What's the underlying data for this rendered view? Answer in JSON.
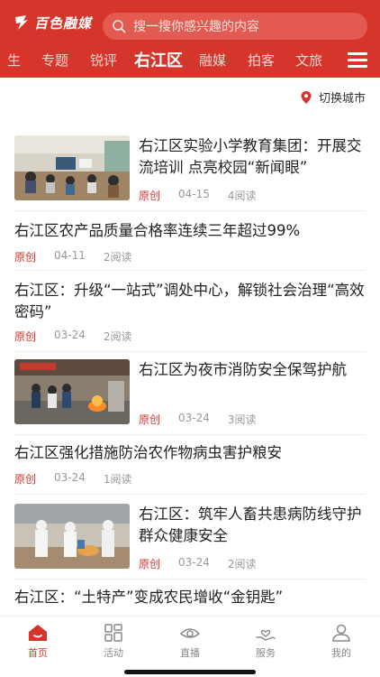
{
  "app": {
    "logo_text": "百色融媒",
    "brand_color": "#d6352b"
  },
  "search": {
    "placeholder": "搜一搜你感兴趣的内容"
  },
  "tabs": [
    {
      "label": "生"
    },
    {
      "label": "专题"
    },
    {
      "label": "锐评"
    },
    {
      "label": "右江区",
      "active": true
    },
    {
      "label": "融媒"
    },
    {
      "label": "拍客"
    },
    {
      "label": "文旅"
    }
  ],
  "city_switch": {
    "label": "切换城市"
  },
  "news": [
    {
      "title": "右江区实验小学教育集团：开展交流培训 点亮校园“新闻眼”",
      "tag": "原创",
      "date": "04-15",
      "reads": "4阅读",
      "has_image": true
    },
    {
      "title": "右江区农产品质量合格率连续三年超过99%",
      "tag": "原创",
      "date": "04-11",
      "reads": "2阅读",
      "has_image": false
    },
    {
      "title": "右江区：升级“一站式”调处中心，解锁社会治理“高效密码”",
      "tag": "原创",
      "date": "03-24",
      "reads": "2阅读",
      "has_image": false
    },
    {
      "title": "右江区为夜市消防安全保驾护航",
      "tag": "原创",
      "date": "03-24",
      "reads": "3阅读",
      "has_image": true
    },
    {
      "title": "右江区强化措施防治农作物病虫害护粮安",
      "tag": "原创",
      "date": "03-24",
      "reads": "1阅读",
      "has_image": false
    },
    {
      "title": "右江区：筑牢人畜共患病防线守护群众健康安全",
      "tag": "原创",
      "date": "03-24",
      "reads": "2阅读",
      "has_image": true
    },
    {
      "title": "右江区：“土特产”变成农民增收“金钥匙”",
      "tag": "",
      "date": "",
      "reads": "",
      "has_image": false
    }
  ],
  "bottom_nav": [
    {
      "label": "首页",
      "icon": "home-icon",
      "active": true
    },
    {
      "label": "活动",
      "icon": "grid-icon"
    },
    {
      "label": "直播",
      "icon": "live-eye-icon"
    },
    {
      "label": "服务",
      "icon": "hand-heart-icon"
    },
    {
      "label": "我的",
      "icon": "person-icon"
    }
  ]
}
